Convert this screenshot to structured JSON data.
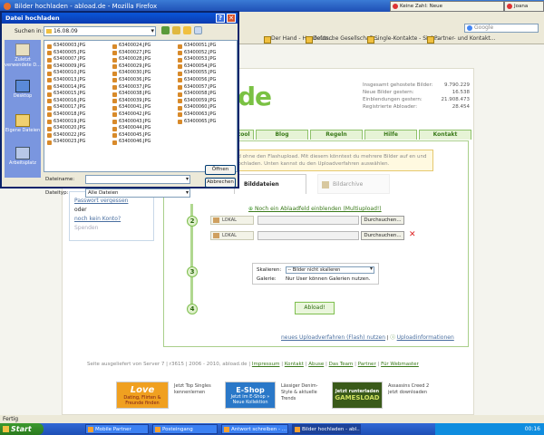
{
  "browser": {
    "title": "Bilder hochladen - abload.de - Mozilla Firefox",
    "search_placeholder": "Google",
    "top_tabs": [
      "Keine Zahl: Neue",
      "Joana"
    ],
    "bookmarks": [
      "Der Hand - Hundefon...",
      "Deutsche Gesellschaft...",
      "Single-Kontakte - Sieh...",
      "Partner- und Kontakt..."
    ],
    "status": "Fertig"
  },
  "site": {
    "logo_text": "de",
    "stats": [
      {
        "label": "Insgesamt gehostete Bilder:",
        "value": "9.790.229"
      },
      {
        "label": "Neue Bilder gestern:",
        "value": "16.538"
      },
      {
        "label": "Einblendungen gestern:",
        "value": "21.908.473"
      },
      {
        "label": "Registrierte Abloader:",
        "value": "28.454"
      }
    ],
    "nav_tabs": [
      "tool",
      "Blog",
      "Regeln",
      "Hilfe",
      "Kontakt"
    ],
    "info_text": "ad ohne den Flashupload. Mit diesem könntest du mehrere Bilder auf en und hochladen. Unten kannst du den Uploadverfahren auswählen.",
    "upload_tabs": {
      "active": "Bilddateien",
      "other": "Bildarchive"
    },
    "more_field_link": "Noch ein Ablaadfeld einblenden (Multiupload!)",
    "file_rows": [
      {
        "label": "LOKAL",
        "button": "Durchsuchen..."
      },
      {
        "label": "LOKAL",
        "button": "Durchsuchen..."
      }
    ],
    "steps": [
      "2",
      "3",
      "4"
    ],
    "scale_label": "Skalieren:",
    "scale_value": "-- Bilder nicht skalieren",
    "gallery_label": "Galerie:",
    "gallery_value": "Nur User können Galerien nutzen.",
    "upload_button": "Abload!",
    "bottom_link_1": "neues Uploadverfahren (Flash) nutzen",
    "bottom_link_2": "Uploadinformationen",
    "footer_prefix": "Seite ausgeliefert von Server 7 | r3615 | 2006 - 2010, abload.de |",
    "footer_links": [
      "Impressum",
      "Kontakt",
      "Abuse",
      "Das Team",
      "Partner",
      "Für Webmaster"
    ],
    "left_box": {
      "link1": "Passwort vergessen",
      "word": "oder",
      "link2": "noch kein Konto?",
      "extra": "Spenden"
    },
    "ads": [
      {
        "title": "Love",
        "sub": "Dating, Flirten & Freunde finden",
        "color": "#f0a020"
      },
      {
        "text": "Jetzt Top Singles kennenlernen"
      },
      {
        "title": "E-Shop",
        "sub": "Jetzt im E-Shop » Neue Kollektion",
        "color": "#2a78c8"
      },
      {
        "text": "Lässiger Denim-Style & aktuelle Trends"
      },
      {
        "title": "Jetzt runterladen",
        "sub": "GAMESLOAD",
        "color": "#3a5a1a"
      },
      {
        "text": "Assassins Creed 2 jetzt downloaden"
      }
    ]
  },
  "taskbar": {
    "start": "Start",
    "tasks": [
      "Mobile Partner",
      "Posteingang",
      "Antwort schreiben - ...",
      "Bilder hochladen - abl..."
    ],
    "clock": "00:16"
  },
  "dialog": {
    "title": "Datei hochladen",
    "lookin_label": "Suchen in:",
    "lookin_value": "16.08.09",
    "places": [
      "Zuletzt verwendete D...",
      "Desktop",
      "Eigene Dateien",
      "Arbeitsplatz"
    ],
    "columns": [
      [
        "63400003.JPG",
        "63400005.JPG",
        "63400007.JPG",
        "63400009.JPG",
        "63400010.JPG",
        "63400013.JPG",
        "63400014.JPG",
        "63400015.JPG",
        "63400016.JPG",
        "63400017.JPG",
        "63400018.JPG",
        "63400019.JPG",
        "63400020.JPG",
        "63400022.JPG",
        "63400023.JPG"
      ],
      [
        "63400024.JPG",
        "63400027.JPG",
        "63400028.JPG",
        "63400029.JPG",
        "63400030.JPG",
        "63400036.JPG",
        "63400037.JPG",
        "63400038.JPG",
        "63400039.JPG",
        "63400041.JPG",
        "63400042.JPG",
        "63400043.JPG",
        "63400044.JPG",
        "63400045.JPG",
        "63400046.JPG"
      ],
      [
        "63400051.JPG",
        "63400052.JPG",
        "63400053.JPG",
        "63400054.JPG",
        "63400055.JPG",
        "63400056.JPG",
        "63400057.JPG",
        "63400058.JPG",
        "63400059.JPG",
        "63400060.JPG",
        "63400063.JPG",
        "63400065.JPG"
      ]
    ],
    "filename_label": "Dateiname:",
    "filename_value": "",
    "filetype_label": "Dateityp:",
    "filetype_value": "Alle Dateien",
    "open_button": "Öffnen",
    "cancel_button": "Abbrechen"
  }
}
